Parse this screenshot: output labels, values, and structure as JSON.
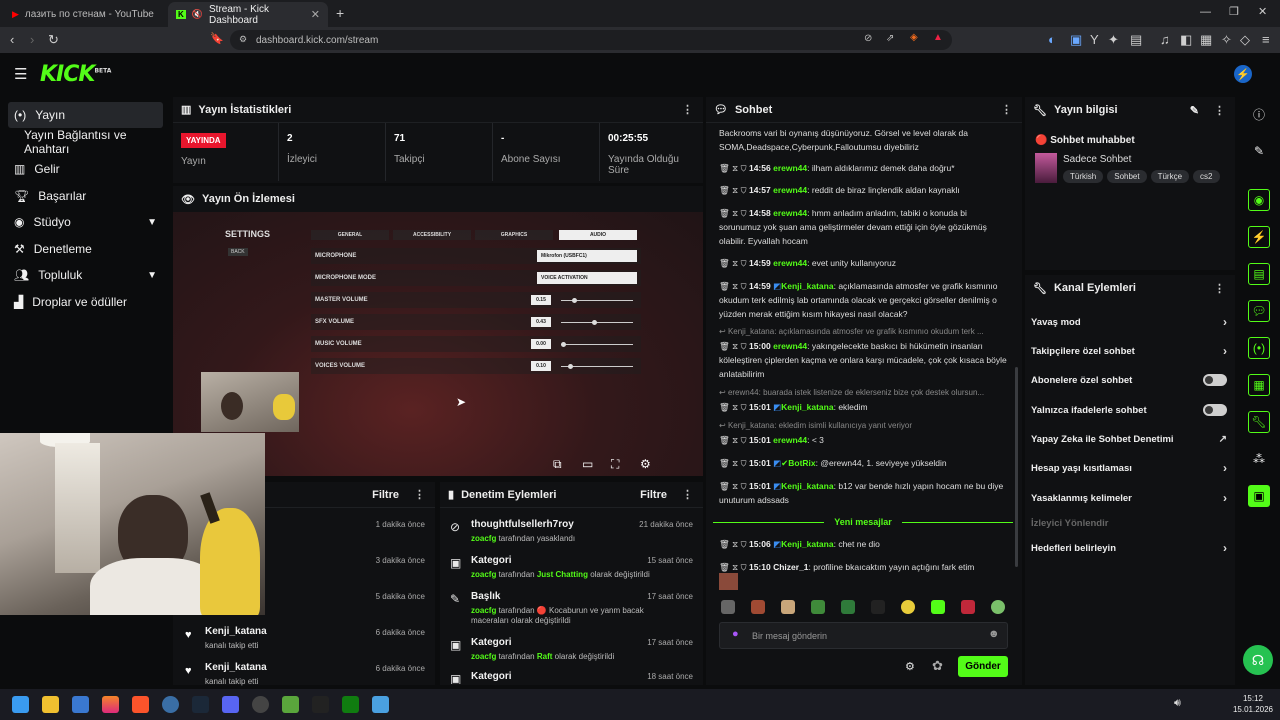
{
  "browser": {
    "tabs": [
      {
        "label": "лазить по стенам - YouTube"
      },
      {
        "label": "Stream - Kick Dashboard"
      }
    ],
    "new_tab": "+",
    "url": "dashboard.kick.com/stream"
  },
  "header": {
    "logo": "KICK",
    "logo_badge": "BETA"
  },
  "sidebar": {
    "items": [
      {
        "label": "Yayın",
        "icon": "broadcast-icon"
      },
      {
        "label": "Yayın Bağlantısı ve Anahtarı"
      },
      {
        "label": "Gelir",
        "icon": "chart-icon"
      },
      {
        "label": "Başarılar",
        "icon": "trophy-icon"
      },
      {
        "label": "Stüdyo",
        "icon": "palette-icon"
      },
      {
        "label": "Denetleme",
        "icon": "hammer-icon"
      },
      {
        "label": "Topluluk",
        "icon": "people-icon"
      },
      {
        "label": "Droplar ve ödüller",
        "icon": "gift-icon"
      }
    ]
  },
  "stats": {
    "title": "Yayın İstatistikleri",
    "live_badge": "YAYINDA",
    "live_label": "Yayın",
    "viewers": {
      "value": "2",
      "label": "İzleyici"
    },
    "followers": {
      "value": "71",
      "label": "Takipçi"
    },
    "subs": {
      "value": "-",
      "label": "Abone Sayısı"
    },
    "uptime": {
      "value": "00:25:55",
      "label": "Yayında Olduğu Süre"
    }
  },
  "preview": {
    "title": "Yayın Ön İzlemesi",
    "game_settings": {
      "title": "SETTINGS",
      "back": "BACK",
      "tabs": [
        "GENERAL",
        "ACCESSIBILITY",
        "GRAPHICS",
        "AUDIO"
      ],
      "rows": [
        {
          "label": "MICROPHONE",
          "value": "Mikrofon (USBFC1)"
        },
        {
          "label": "MICROPHONE MODE",
          "value": "VOICE ACTIVATION"
        },
        {
          "label": "MASTER VOLUME",
          "value": "0.15",
          "level": 0.15
        },
        {
          "label": "SFX VOLUME",
          "value": "0.43",
          "level": 0.43
        },
        {
          "label": "MUSIC VOLUME",
          "value": "0.00",
          "level": 0.0
        },
        {
          "label": "VOICES VOLUME",
          "value": "0.10",
          "level": 0.1
        }
      ]
    }
  },
  "followers_panel": {
    "filter": "Filtre",
    "items": [
      {
        "time": "1 dakika önce"
      },
      {
        "time": "3 dakika önce"
      },
      {
        "time": "5 dakika önce"
      },
      {
        "name": "Kenji_katana",
        "sub": "kanalı takip etti",
        "time": "6 dakika önce"
      },
      {
        "name": "Kenji_katana",
        "sub": "kanalı takip etti",
        "time": "6 dakika önce"
      }
    ]
  },
  "mod_panel": {
    "title": "Denetim Eylemleri",
    "filter": "Filtre",
    "items": [
      {
        "name": "thoughtfulsellerh7roy",
        "user": "zoacfg",
        "text": "tarafından yasaklandı",
        "time": "21 dakika önce"
      },
      {
        "name": "Kategori",
        "user": "zoacfg",
        "text": "tarafından",
        "hl": "Just Chatting",
        "text2": "olarak değiştirildi",
        "time": "15 saat önce"
      },
      {
        "name": "Başlık",
        "user": "zoacfg",
        "text": "tarafından 🔴 Kocaburun ve yanm bacak maceraları olarak değiştirildi",
        "time": "17 saat önce"
      },
      {
        "name": "Kategori",
        "user": "zoacfg",
        "text": "tarafından",
        "hl": "Raft",
        "text2": "olarak değiştirildi",
        "time": "17 saat önce"
      },
      {
        "name": "Kategori",
        "time": "18 saat önce"
      }
    ]
  },
  "chat": {
    "title": "Sohbet",
    "top_text": "Backrooms vari bi oynanış düşünüyoruz. Görsel ve level olarak da SOMA,Deadspace,Cyberpunk,Falloutumsu diyebiliriz",
    "messages": [
      {
        "time": "14:56",
        "user": "erewn44",
        "text": "ilham aldıklarımız demek daha doğru*"
      },
      {
        "time": "14:57",
        "user": "erewn44",
        "text": "reddit de biraz linçlendik aldan kaynaklı"
      },
      {
        "time": "14:58",
        "user": "erewn44",
        "text": "hmm anladım anladım, tabiki o konuda bi sorunumuz yok şuan ama geliştirmeler devam ettiği için öyle gözükmüş olabilir. Eyvallah hocam"
      },
      {
        "time": "14:59",
        "user": "erewn44",
        "text": "evet unity kullanıyoruz"
      },
      {
        "time": "14:59",
        "user": "Kenji_katana",
        "text": "açıklamasında atmosfer ve grafik kısmınıo okudum terk edilmiş lab ortamında olacak ve gerçekci görseller denilmiş o yüzden merak ettiğim kısım hikayesi nasıl olacak?"
      },
      {
        "reply": "Kenji_katana: açıklamasında atmosfer ve grafik kısmınıo okudum terk ...",
        "time": "15:00",
        "user": "erewn44",
        "text": "yakıngelecekte baskıcı bi hükümetin insanları köleleştiren çiplerden kaçma ve onlara karşı mücadele, çok çok kısaca böyle anlatabilirim"
      },
      {
        "reply": "erewn44: buarada istek listenize de eklerseniz bize çok destek olursun...",
        "time": "15:01",
        "user": "Kenji_katana",
        "text": "ekledim"
      },
      {
        "reply": "Kenji_katana: ekledim isimli kullanıcıya yanıt veriyor",
        "time": "15:01",
        "user": "erewn44",
        "text": "< 3"
      },
      {
        "time": "15:01",
        "user": "BotRix",
        "text": "@erewn44, 1. seviyeye yükseldin"
      },
      {
        "time": "15:01",
        "user": "Kenji_katana",
        "text": "b12 var bende hızlı yapın hocam ne bu diye unuturum adssads"
      }
    ],
    "new_messages": "Yeni mesajlar",
    "after": [
      {
        "time": "15:06",
        "user": "Kenji_katana",
        "text": "chet ne dio"
      },
      {
        "time": "15:10",
        "user": "Chizer_1",
        "text": "profiline bkaıcaktım yayın açtığını fark etim"
      }
    ],
    "input_placeholder": "Bir mesaj gönderin",
    "send": "Gönder"
  },
  "stream_info": {
    "title": "Yayın bilgisi",
    "stream_title": "🔴 Sohbet muhabbet",
    "category": "Sadece Sohbet",
    "tags": [
      "Türkish",
      "Sohbet",
      "Türkçe",
      "cs2"
    ]
  },
  "channel_actions": {
    "title": "Kanal Eylemleri",
    "items": [
      {
        "label": "Yavaş mod",
        "control": "arrow"
      },
      {
        "label": "Takipçilere özel sohbet",
        "control": "arrow"
      },
      {
        "label": "Abonelere özel sohbet",
        "control": "toggle",
        "on": false
      },
      {
        "label": "Yalnızca ifadelerle sohbet",
        "control": "toggle",
        "on": false
      },
      {
        "label": "Yapay Zeka ile Sohbet Denetimi",
        "control": "external"
      },
      {
        "label": "Hesap yaşı kısıtlaması",
        "control": "arrow"
      },
      {
        "label": "Yasaklanmış kelimeler",
        "control": "arrow"
      },
      {
        "label": "İzleyici Yönlendir",
        "control": "disabled"
      },
      {
        "label": "Hedefleri belirleyin",
        "control": "arrow"
      }
    ]
  },
  "taskbar": {
    "time": "15:12",
    "date": "15.01.2026"
  },
  "colors": {
    "brand": "#53fc18",
    "live": "#e8162d"
  }
}
